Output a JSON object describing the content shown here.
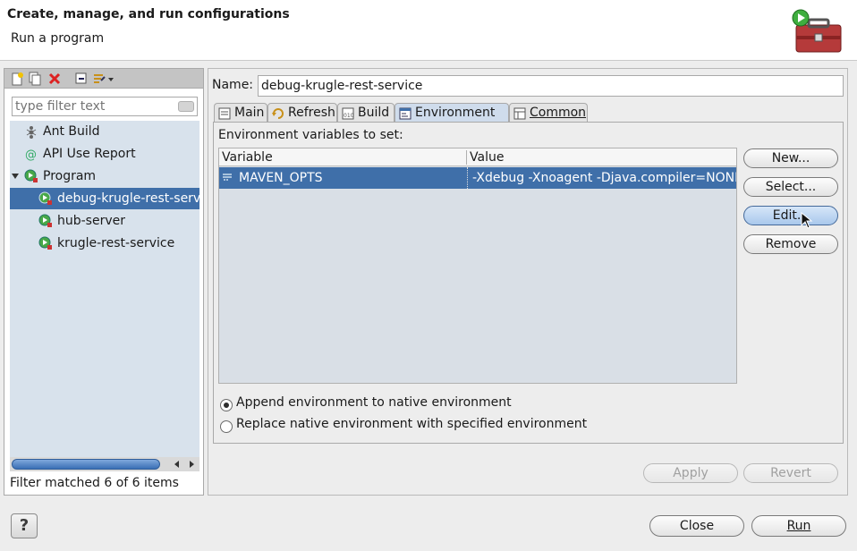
{
  "header": {
    "title": "Create, manage, and run configurations",
    "subtitle": "Run a program",
    "icon": "toolbox-run-icon"
  },
  "left_panel": {
    "toolbar_icons": [
      "new-launch-config-icon",
      "duplicate-icon",
      "delete-icon",
      "collapse-all-icon",
      "filter-icon",
      "dropdown-icon"
    ],
    "filter_placeholder": "type filter text",
    "tree": [
      {
        "label": "Ant Build",
        "icon": "ant-icon",
        "level": 0,
        "selected": false
      },
      {
        "label": "API Use Report",
        "icon": "api-report-icon",
        "level": 0,
        "selected": false
      },
      {
        "label": "Program",
        "icon": "program-icon",
        "level": 0,
        "expanded": true,
        "selected": false
      },
      {
        "label": "debug-krugle-rest-service",
        "icon": "program-config-icon",
        "level": 1,
        "selected": true
      },
      {
        "label": "hub-server",
        "icon": "program-config-icon",
        "level": 1,
        "selected": false
      },
      {
        "label": "krugle-rest-service",
        "icon": "program-config-icon",
        "level": 1,
        "selected": false
      }
    ],
    "status": "Filter matched 6 of 6 items"
  },
  "right_panel": {
    "name_label": "Name:",
    "name_value": "debug-krugle-rest-service",
    "tabs": [
      {
        "label": "Main",
        "icon": "main-tab-icon",
        "active": false
      },
      {
        "label": "Refresh",
        "icon": "refresh-icon",
        "active": false
      },
      {
        "label": "Build",
        "icon": "build-icon",
        "active": false
      },
      {
        "label": "Environment",
        "icon": "environment-icon",
        "active": true
      },
      {
        "label": "Common",
        "icon": "common-icon",
        "active": false
      }
    ],
    "env_label": "Environment variables to set:",
    "table": {
      "columns": [
        "Variable",
        "Value"
      ],
      "rows": [
        {
          "variable": "MAVEN_OPTS",
          "value": "-Xdebug -Xnoagent -Djava.compiler=NONE -",
          "icon": "env-var-icon",
          "selected": true
        }
      ]
    },
    "buttons": {
      "new": "New...",
      "select": "Select...",
      "edit": "Edit...",
      "remove": "Remove"
    },
    "radios": {
      "append": "Append environment to native environment",
      "replace": "Replace native environment with specified environment",
      "selected": "append"
    },
    "apply": "Apply",
    "revert": "Revert"
  },
  "footer": {
    "help": "?",
    "close": "Close",
    "run": "Run"
  }
}
